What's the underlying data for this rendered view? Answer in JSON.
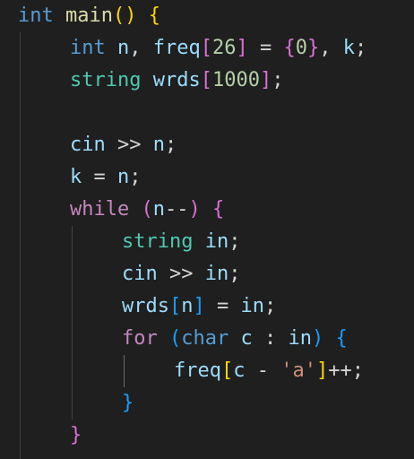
{
  "editor": {
    "language": "cpp",
    "lines": [
      {
        "indent": 0,
        "tokens": [
          {
            "t": "int",
            "c": "kw-type"
          },
          {
            "t": " "
          },
          {
            "t": "main",
            "c": "fn"
          },
          {
            "t": "()",
            "c": "b1"
          },
          {
            "t": " "
          },
          {
            "t": "{",
            "c": "b1"
          }
        ]
      },
      {
        "indent": 1,
        "tokens": [
          {
            "t": "int",
            "c": "kw-type"
          },
          {
            "t": " "
          },
          {
            "t": "n",
            "c": "var"
          },
          {
            "t": ", "
          },
          {
            "t": "freq",
            "c": "var"
          },
          {
            "t": "[",
            "c": "b2"
          },
          {
            "t": "26",
            "c": "num"
          },
          {
            "t": "]",
            "c": "b2"
          },
          {
            "t": " = "
          },
          {
            "t": "{",
            "c": "b2"
          },
          {
            "t": "0",
            "c": "num"
          },
          {
            "t": "}",
            "c": "b2"
          },
          {
            "t": ", "
          },
          {
            "t": "k",
            "c": "var"
          },
          {
            "t": ";"
          }
        ]
      },
      {
        "indent": 1,
        "tokens": [
          {
            "t": "string",
            "c": "type"
          },
          {
            "t": " "
          },
          {
            "t": "wrds",
            "c": "var"
          },
          {
            "t": "[",
            "c": "b2"
          },
          {
            "t": "1000",
            "c": "num"
          },
          {
            "t": "]",
            "c": "b2"
          },
          {
            "t": ";"
          }
        ]
      },
      {
        "indent": 0,
        "tokens": []
      },
      {
        "indent": 1,
        "tokens": [
          {
            "t": "cin",
            "c": "var"
          },
          {
            "t": " >> "
          },
          {
            "t": "n",
            "c": "var"
          },
          {
            "t": ";"
          }
        ]
      },
      {
        "indent": 1,
        "tokens": [
          {
            "t": "k",
            "c": "var"
          },
          {
            "t": " = "
          },
          {
            "t": "n",
            "c": "var"
          },
          {
            "t": ";"
          }
        ]
      },
      {
        "indent": 1,
        "tokens": [
          {
            "t": "while",
            "c": "kw-ctrl"
          },
          {
            "t": " "
          },
          {
            "t": "(",
            "c": "b2"
          },
          {
            "t": "n",
            "c": "var"
          },
          {
            "t": "--"
          },
          {
            "t": ")",
            "c": "b2"
          },
          {
            "t": " "
          },
          {
            "t": "{",
            "c": "b2"
          }
        ]
      },
      {
        "indent": 2,
        "tokens": [
          {
            "t": "string",
            "c": "type"
          },
          {
            "t": " "
          },
          {
            "t": "in",
            "c": "var"
          },
          {
            "t": ";"
          }
        ]
      },
      {
        "indent": 2,
        "tokens": [
          {
            "t": "cin",
            "c": "var"
          },
          {
            "t": " >> "
          },
          {
            "t": "in",
            "c": "var"
          },
          {
            "t": ";"
          }
        ]
      },
      {
        "indent": 2,
        "tokens": [
          {
            "t": "wrds",
            "c": "var"
          },
          {
            "t": "[",
            "c": "b3"
          },
          {
            "t": "n",
            "c": "var"
          },
          {
            "t": "]",
            "c": "b3"
          },
          {
            "t": " = "
          },
          {
            "t": "in",
            "c": "var"
          },
          {
            "t": ";"
          }
        ]
      },
      {
        "indent": 2,
        "tokens": [
          {
            "t": "for",
            "c": "kw-ctrl"
          },
          {
            "t": " "
          },
          {
            "t": "(",
            "c": "b3"
          },
          {
            "t": "char",
            "c": "kw-type"
          },
          {
            "t": " "
          },
          {
            "t": "c",
            "c": "var"
          },
          {
            "t": " : "
          },
          {
            "t": "in",
            "c": "var"
          },
          {
            "t": ")",
            "c": "b3"
          },
          {
            "t": " "
          },
          {
            "t": "{",
            "c": "b3"
          }
        ]
      },
      {
        "indent": 3,
        "tokens": [
          {
            "t": "freq",
            "c": "var"
          },
          {
            "t": "[",
            "c": "b1"
          },
          {
            "t": "c",
            "c": "var"
          },
          {
            "t": " - "
          },
          {
            "t": "'a'",
            "c": "str"
          },
          {
            "t": "]",
            "c": "b1"
          },
          {
            "t": "++;"
          }
        ]
      },
      {
        "indent": 2,
        "tokens": [
          {
            "t": "}",
            "c": "b3"
          }
        ]
      },
      {
        "indent": 1,
        "tokens": [
          {
            "t": "}",
            "c": "b2"
          }
        ]
      }
    ]
  },
  "colors": {
    "background": "#1f1f1f",
    "keyword_type": "#569cd6",
    "keyword_control": "#c586c0",
    "function": "#dcdcaa",
    "variable": "#9cdcfe",
    "number": "#b5cea8",
    "string": "#ce9178",
    "type": "#4ec9b0",
    "bracket_1": "#ffd700",
    "bracket_2": "#da70d6",
    "bracket_3": "#179fff"
  }
}
